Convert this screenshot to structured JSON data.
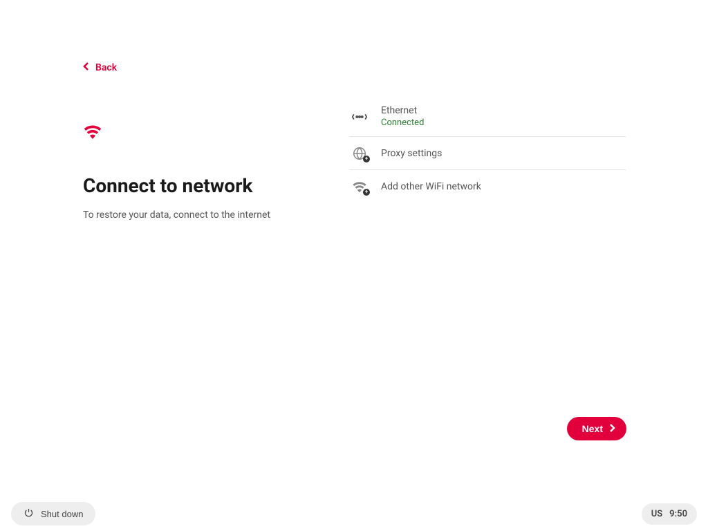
{
  "nav": {
    "back_label": "Back"
  },
  "left": {
    "title": "Connect to network",
    "subtitle": "To restore your data, connect to the internet"
  },
  "networks": {
    "ethernet": {
      "label": "Ethernet",
      "status": "Connected"
    },
    "proxy": {
      "label": "Proxy settings"
    },
    "add_wifi": {
      "label": "Add other WiFi network"
    }
  },
  "actions": {
    "next_label": "Next",
    "shutdown_label": "Shut down"
  },
  "status": {
    "keyboard": "US",
    "time": "9:50"
  },
  "colors": {
    "accent": "#e1003c",
    "connected": "#2e7d32"
  }
}
